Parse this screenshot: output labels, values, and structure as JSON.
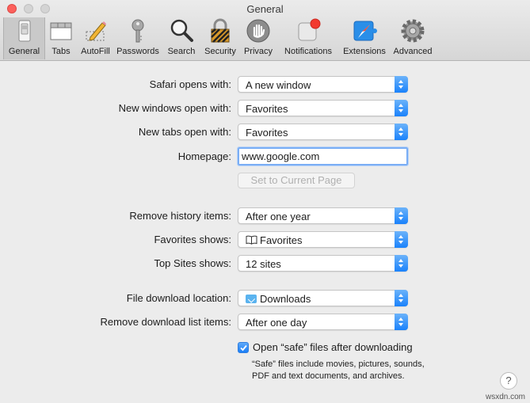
{
  "window": {
    "title": "General"
  },
  "toolbar": {
    "items": [
      {
        "label": "General",
        "icon": "general-switch-icon"
      },
      {
        "label": "Tabs",
        "icon": "tabs-icon"
      },
      {
        "label": "AutoFill",
        "icon": "autofill-pencil-icon"
      },
      {
        "label": "Passwords",
        "icon": "key-icon"
      },
      {
        "label": "Search",
        "icon": "magnifier-icon"
      },
      {
        "label": "Security",
        "icon": "padlock-icon"
      },
      {
        "label": "Privacy",
        "icon": "hand-icon"
      },
      {
        "label": "Notifications",
        "icon": "notification-badge-icon"
      },
      {
        "label": "Extensions",
        "icon": "compass-puzzle-icon"
      },
      {
        "label": "Advanced",
        "icon": "gear-icon"
      }
    ],
    "selected": "General"
  },
  "general": {
    "safari_opens_with": {
      "label": "Safari opens with:",
      "value": "A new window"
    },
    "new_windows_open_with": {
      "label": "New windows open with:",
      "value": "Favorites"
    },
    "new_tabs_open_with": {
      "label": "New tabs open with:",
      "value": "Favorites"
    },
    "homepage": {
      "label": "Homepage:",
      "value": "www.google.com"
    },
    "set_current_page": "Set to Current Page",
    "remove_history": {
      "label": "Remove history items:",
      "value": "After one year"
    },
    "favorites_shows": {
      "label": "Favorites shows:",
      "value": "Favorites"
    },
    "top_sites_shows": {
      "label": "Top Sites shows:",
      "value": "12 sites"
    },
    "download_location": {
      "label": "File download location:",
      "value": "Downloads"
    },
    "remove_download_list": {
      "label": "Remove download list items:",
      "value": "After one day"
    },
    "open_safe_files": {
      "label": "Open “safe” files after downloading",
      "checked": true
    },
    "safe_files_note": "“Safe” files include movies, pictures, sounds, PDF and text documents, and archives."
  },
  "help_label": "?",
  "watermark": "wsxdn.com",
  "colors": {
    "accent": "#1a82fb",
    "close": "#fc605c",
    "badge": "#f23a2f"
  }
}
